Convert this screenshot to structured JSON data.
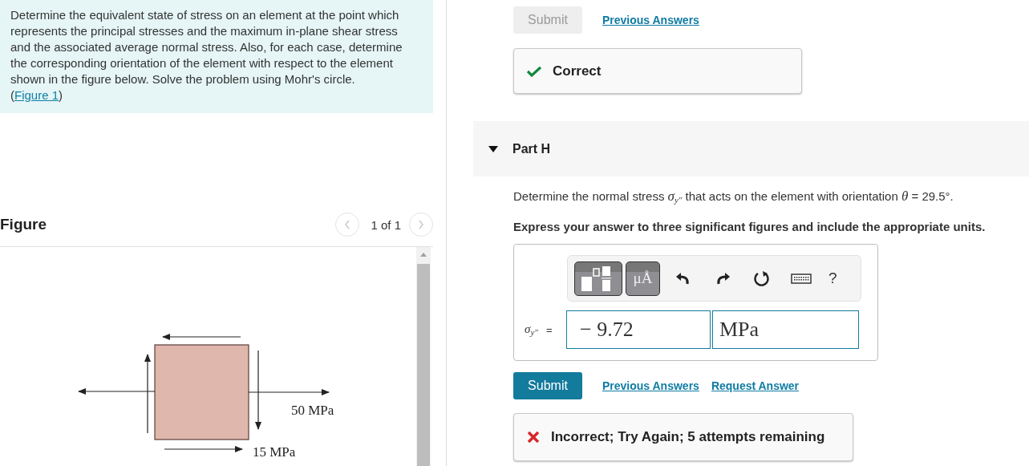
{
  "problem": {
    "text": "Determine the equivalent state of stress on an element at the point which represents the principal stresses and the maximum in-plane shear stress and the associated average normal stress. Also, for each case, determine the corresponding orientation of the element with respect to the element shown in the figure below. Solve the problem using Mohr's circle. (",
    "link": "Figure 1",
    "text_after": ")"
  },
  "figure": {
    "title": "Figure",
    "pager": "1 of 1",
    "prev_disabled": true,
    "next_disabled": true,
    "labels": [
      "50 MPa",
      "15 MPa"
    ]
  },
  "previous_part": {
    "submit": {
      "label": "Submit",
      "disabled": true
    },
    "links": [
      "Previous Answers"
    ],
    "feedback": {
      "kind": "correct",
      "text": "Correct"
    }
  },
  "part": {
    "title": "Part H",
    "expanded": true,
    "question": [
      {
        "kind": "text",
        "text": "Determine the normal stress "
      },
      {
        "kind": "math",
        "text": "σ",
        "sub": "y″"
      },
      {
        "kind": "text",
        "text": " that acts on the element with orientation "
      },
      {
        "kind": "math",
        "text": "θ"
      },
      {
        "kind": "text",
        "text": " = 29.5°."
      }
    ],
    "instruction": "Express your answer to three significant figures and include the appropriate units.",
    "toolbar": {
      "units_button": "μÅ",
      "help": "?"
    },
    "answer": {
      "symbol": "σ",
      "sub": "y″",
      "equals": "=",
      "value": "− 9.72",
      "unit": "MPa"
    },
    "submit": {
      "label": "Submit",
      "disabled": false
    },
    "links": [
      "Previous Answers",
      "Request Answer"
    ],
    "feedback": {
      "kind": "incorrect",
      "text": "Incorrect; Try Again; 5 attempts remaining"
    }
  }
}
